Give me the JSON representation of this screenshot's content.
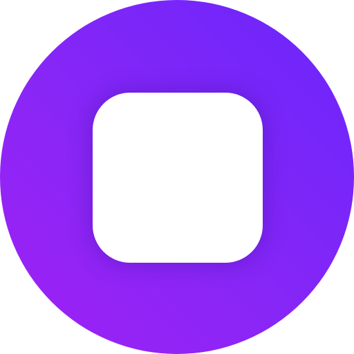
{
  "app_icon": {
    "icon": "stop-icon",
    "colors": {
      "gradient_start": "#a020f5",
      "gradient_end": "#6a26fc",
      "glyph": "#ffffff"
    }
  }
}
